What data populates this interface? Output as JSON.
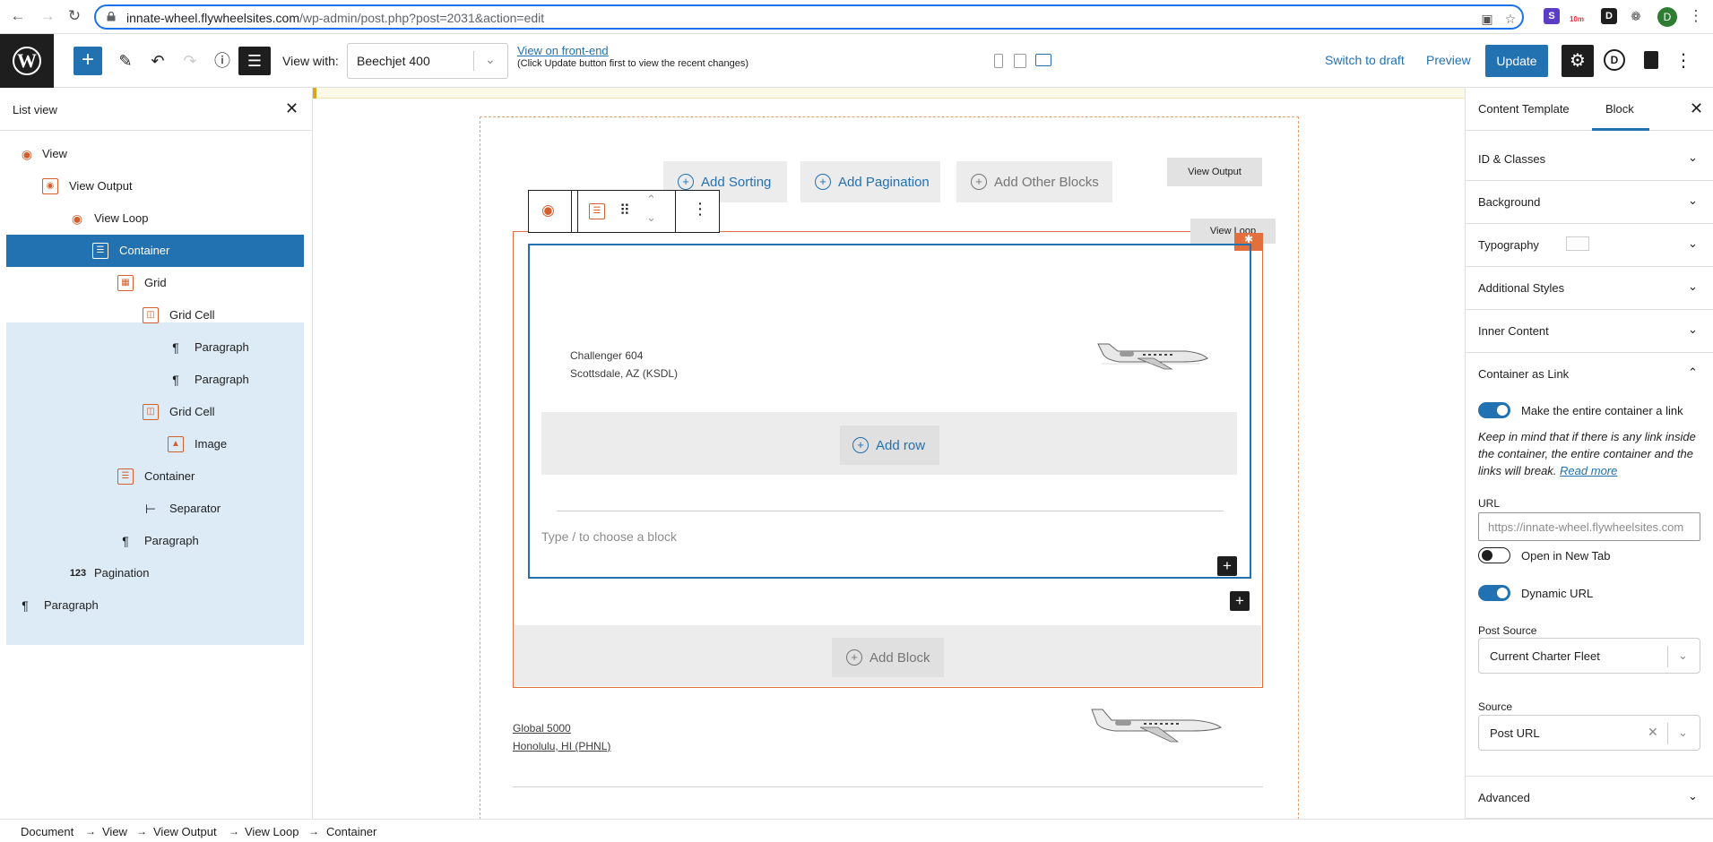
{
  "browser": {
    "url_host": "innate-wheel.flywheelsites.com",
    "url_path": "/wp-admin/post.php?post=2031&action=edit",
    "extension_badge": "10m",
    "profile_initial": "D"
  },
  "toolbar": {
    "view_with_label": "View with:",
    "view_with_value": "Beechjet 400",
    "frontend_link": "View on front-end",
    "frontend_note": "(Click Update button first to view the recent changes)",
    "switch_to_draft": "Switch to draft",
    "preview": "Preview",
    "update": "Update",
    "plugin_initial": "D"
  },
  "listview": {
    "title": "List view",
    "items": [
      {
        "label": "View",
        "icon": "view-icon"
      },
      {
        "label": "View Output",
        "icon": "view-output-icon"
      },
      {
        "label": "View Loop",
        "icon": "view-loop-icon"
      },
      {
        "label": "Container",
        "icon": "container-icon",
        "selected": true
      },
      {
        "label": "Grid",
        "icon": "grid-icon"
      },
      {
        "label": "Grid Cell",
        "icon": "grid-cell-icon"
      },
      {
        "label": "Paragraph",
        "icon": "paragraph-icon"
      },
      {
        "label": "Paragraph",
        "icon": "paragraph-icon"
      },
      {
        "label": "Grid Cell",
        "icon": "grid-cell-icon"
      },
      {
        "label": "Image",
        "icon": "image-icon"
      },
      {
        "label": "Container",
        "icon": "container-icon"
      },
      {
        "label": "Separator",
        "icon": "separator-icon"
      },
      {
        "label": "Paragraph",
        "icon": "paragraph-icon"
      },
      {
        "label": "Pagination",
        "icon": "pagination-icon"
      },
      {
        "label": "Paragraph",
        "icon": "paragraph-icon"
      }
    ]
  },
  "canvas": {
    "add_sorting": "Add Sorting",
    "add_pagination": "Add Pagination",
    "add_other_blocks": "Add Other Blocks",
    "view_output_tag": "View Output",
    "view_loop_tag": "View Loop",
    "card1_title": "Challenger 604",
    "card1_location": "Scottsdale, AZ (KSDL)",
    "add_row": "Add row",
    "placeholder": "Type / to choose a block",
    "add_block": "Add Block",
    "card2_title": "Global 5000",
    "card2_location": "Honolulu, HI (PHNL)"
  },
  "sidebar": {
    "tab_content_template": "Content Template",
    "tab_block": "Block",
    "panels": {
      "id_classes": "ID & Classes",
      "background": "Background",
      "typography": "Typography",
      "additional_styles": "Additional Styles",
      "inner_content": "Inner Content",
      "container_as_link": "Container as Link",
      "advanced": "Advanced"
    },
    "make_link_label": "Make the entire container a link",
    "help_text": "Keep in mind that if there is any link inside the container, the entire container and the links will break.",
    "read_more": "Read more",
    "url_label": "URL",
    "url_placeholder": "https://innate-wheel.flywheelsites.com",
    "open_new_tab": "Open in New Tab",
    "dynamic_url": "Dynamic URL",
    "post_source_label": "Post Source",
    "post_source_value": "Current Charter Fleet",
    "source_label": "Source",
    "source_value": "Post URL"
  },
  "breadcrumb": [
    "Document",
    "View",
    "View Output",
    "View Loop",
    "Container"
  ],
  "colors": {
    "accent": "#2271b1",
    "orange": "#e26f3c",
    "selected_tint": "#dcebf6"
  }
}
